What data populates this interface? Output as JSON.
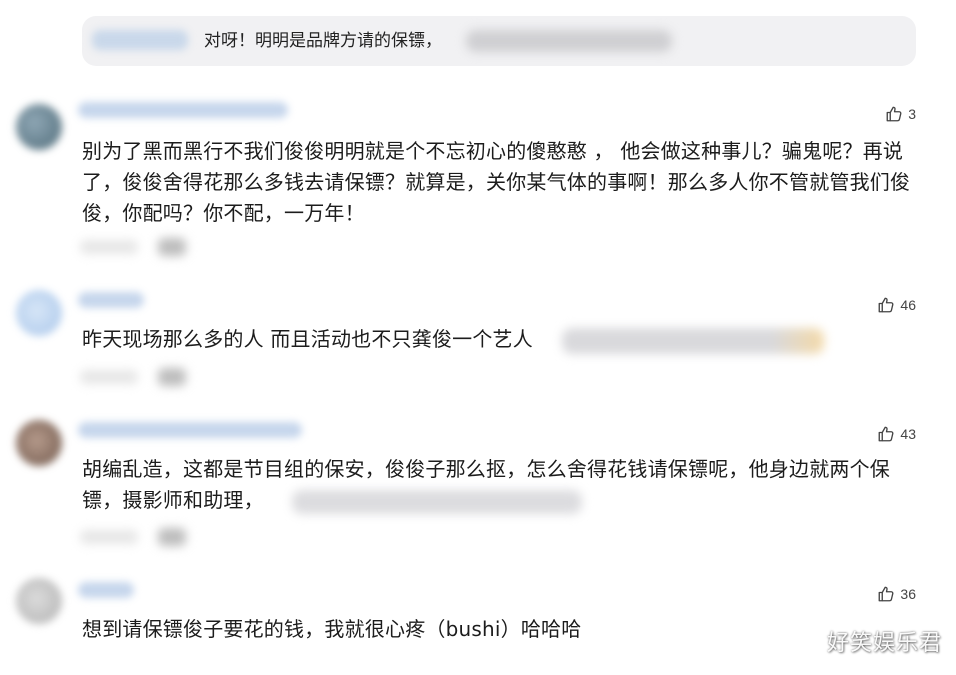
{
  "reply": {
    "text": "对呀！明明是品牌方请的保镖，"
  },
  "comments": [
    {
      "likes": "3",
      "text": "别为了黑而黑行不我们俊俊明明就是个不忘初心的傻憨憨 ， 他会做这种事儿？骗鬼呢？再说了，俊俊舍得花那么多钱去请保镖？就算是，关你某气体的事啊！那么多人你不管就管我们俊俊，你配吗？你不配，一万年！"
    },
    {
      "likes": "46",
      "text": "昨天现场那么多的人 而且活动也不只龚俊一个艺人"
    },
    {
      "likes": "43",
      "text": "胡编乱造，这都是节目组的保安，俊俊子那么抠，怎么舍得花钱请保镖呢，他身边就两个保镖，摄影师和助理，"
    },
    {
      "likes": "36",
      "text": "想到请保镖俊子要花的钱，我就很心疼（bushi）哈哈哈"
    }
  ],
  "watermark": "好笑娱乐君",
  "colors": {
    "bubble_bg": "#f1f1f3",
    "text": "#1c1c1c",
    "like_icon": "#444444"
  }
}
